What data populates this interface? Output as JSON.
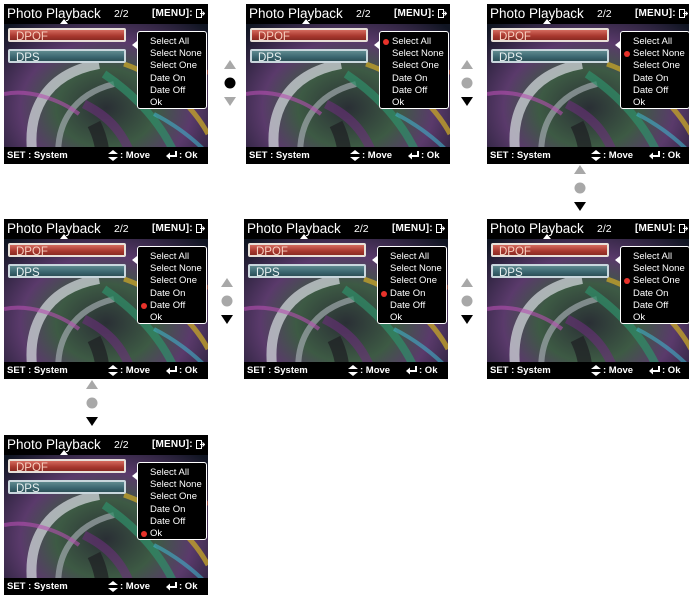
{
  "screen_common": {
    "title": "Photo Playback",
    "page": "2/2",
    "menu_hint": "[MENU]:",
    "tabs": [
      "DPOF",
      "DPS"
    ],
    "options": [
      "Select All",
      "Select None",
      "Select One",
      "Date On",
      "Date Off",
      "Ok"
    ],
    "bottom": {
      "set_hint": "SET : System",
      "move_hint": ": Move",
      "ok_hint": ": Ok"
    }
  },
  "screens": [
    {
      "selected_option": "none"
    },
    {
      "selected_option": "Select All"
    },
    {
      "selected_option": "Select None"
    },
    {
      "selected_option": "Select One"
    },
    {
      "selected_option": "Date On"
    },
    {
      "selected_option": "Date Off"
    },
    {
      "selected_option": "Ok"
    }
  ],
  "navigators": [
    {
      "active": "dot"
    },
    {
      "active": "down"
    },
    {
      "active": "down"
    },
    {
      "active": "down"
    },
    {
      "active": "down"
    },
    {
      "active": "down"
    }
  ],
  "colors": {
    "selection_dot": "#e8322a",
    "active_arrow": "#000000",
    "inactive_arrow": "#a8a8a8",
    "dpof_tab": "#b84438",
    "dps_tab": "#44707a"
  },
  "icons": [
    "exit-icon",
    "move-updown-icon",
    "enter-return-icon",
    "selection-dot-icon",
    "up-arrow-icon",
    "down-arrow-icon",
    "circle-dot-icon"
  ]
}
